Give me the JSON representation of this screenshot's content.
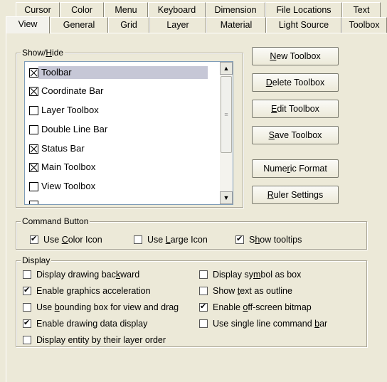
{
  "tabs": {
    "back": [
      "Cursor",
      "Color",
      "Menu",
      "Keyboard",
      "Dimension",
      "File Locations",
      "Text"
    ],
    "front": [
      "View",
      "General",
      "Grid",
      "Layer",
      "Material",
      "Light Source",
      "Toolbox"
    ],
    "active": "View"
  },
  "show_hide": {
    "title_pre": "Show/",
    "title_ul": "H",
    "title_post": "ide",
    "items": [
      {
        "label": "Toolbar",
        "checked": true,
        "selected": true
      },
      {
        "label": "Coordinate Bar",
        "checked": true
      },
      {
        "label": "Layer Toolbox",
        "checked": false
      },
      {
        "label": "Double Line Bar",
        "checked": false
      },
      {
        "label": "Status Bar",
        "checked": true
      },
      {
        "label": "Main Toolbox",
        "checked": true
      },
      {
        "label": "View Toolbox",
        "checked": false
      }
    ]
  },
  "buttons": {
    "new": {
      "pre": "",
      "ul": "N",
      "post": "ew Toolbox"
    },
    "delete": {
      "pre": "",
      "ul": "D",
      "post": "elete Toolbox"
    },
    "edit": {
      "pre": "",
      "ul": "E",
      "post": "dit Toolbox"
    },
    "save": {
      "pre": "",
      "ul": "S",
      "post": "ave Toolbox"
    },
    "numeric": {
      "pre": "Nume",
      "ul": "r",
      "post": "ic Format"
    },
    "ruler": {
      "pre": "",
      "ul": "R",
      "post": "uler Settings"
    }
  },
  "command_button": {
    "title": "Command Button",
    "use_color_icon": {
      "pre": "Use ",
      "ul": "C",
      "post": "olor Icon",
      "checked": true
    },
    "use_large_icon": {
      "pre": "Use ",
      "ul": "L",
      "post": "arge Icon",
      "checked": false
    },
    "show_tooltips": {
      "pre": "S",
      "ul": "h",
      "post": "ow tooltips",
      "checked": true
    }
  },
  "display": {
    "title": "Display",
    "left": [
      {
        "pre": "Display drawing bac",
        "ul": "k",
        "post": "ward",
        "checked": false
      },
      {
        "pre": "Enable graphics acceleration",
        "ul": "",
        "post": "",
        "checked": true
      },
      {
        "pre": "Use ",
        "ul": "b",
        "post": "ounding box for view and drag",
        "checked": false
      },
      {
        "pre": "Enable drawing data display",
        "ul": "",
        "post": "",
        "checked": true
      },
      {
        "pre": "Display entity by their layer order",
        "ul": "",
        "post": "",
        "checked": false
      }
    ],
    "right": [
      {
        "pre": "Display sy",
        "ul": "m",
        "post": "bol as box",
        "checked": false
      },
      {
        "pre": "Show ",
        "ul": "t",
        "post": "ext as outline",
        "checked": false
      },
      {
        "pre": "Enable ",
        "ul": "o",
        "post": "ff-screen bitmap",
        "checked": true
      },
      {
        "pre": "Use single line command ",
        "ul": "b",
        "post": "ar",
        "checked": false
      }
    ]
  }
}
